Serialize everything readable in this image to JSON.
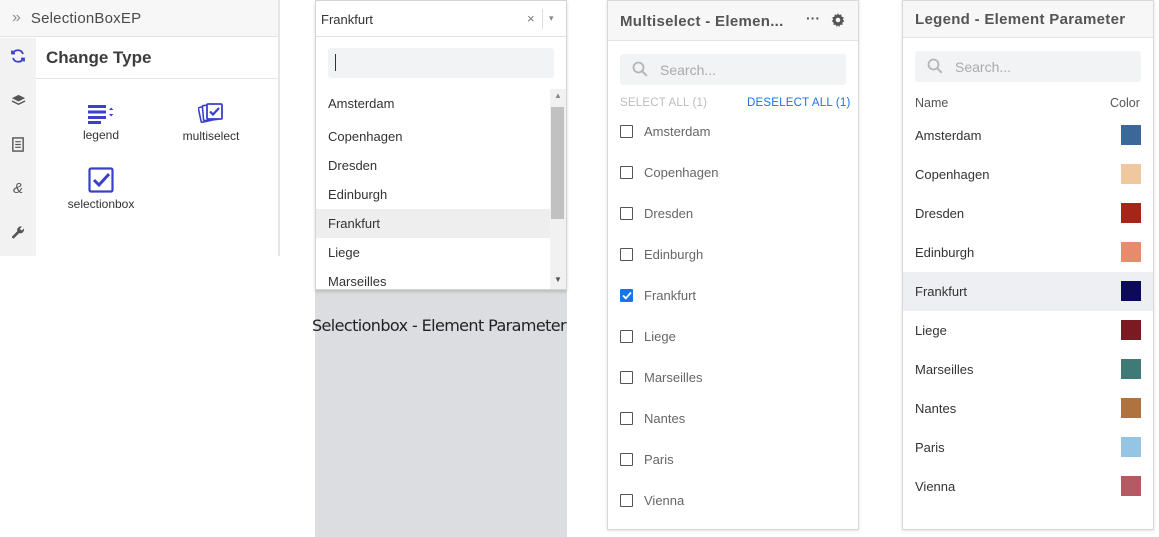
{
  "change_type": {
    "title": "SelectionBoxEP",
    "heading": "Change Type",
    "rail_icons": [
      "refresh-icon",
      "layers-icon",
      "document-icon",
      "ampersand-icon",
      "wrench-icon"
    ],
    "tiles": [
      {
        "label": "legend",
        "icon": "legend-icon"
      },
      {
        "label": "multiselect",
        "icon": "multiselect-icon"
      },
      {
        "label": "selectionbox",
        "icon": "selectionbox-icon"
      }
    ]
  },
  "selectionbox": {
    "value": "Frankfurt",
    "clear_symbol": "×",
    "arrow_symbol": "▾",
    "search_value": "",
    "items": [
      "Amsterdam",
      "Copenhagen",
      "Dresden",
      "Edinburgh",
      "Frankfurt",
      "Liege",
      "Marseilles"
    ],
    "selected": "Frankfurt",
    "caption": "Selectionbox - Element Parameter"
  },
  "multiselect": {
    "title": "Multiselect - Elemen...",
    "menu_symbol": "···",
    "search_placeholder": "Search...",
    "select_all": "SELECT ALL (1)",
    "deselect_all": "DESELECT ALL (1)",
    "items": [
      {
        "label": "Amsterdam",
        "checked": false
      },
      {
        "label": "Copenhagen",
        "checked": false
      },
      {
        "label": "Dresden",
        "checked": false
      },
      {
        "label": "Edinburgh",
        "checked": false
      },
      {
        "label": "Frankfurt",
        "checked": true
      },
      {
        "label": "Liege",
        "checked": false
      },
      {
        "label": "Marseilles",
        "checked": false
      },
      {
        "label": "Nantes",
        "checked": false
      },
      {
        "label": "Paris",
        "checked": false
      },
      {
        "label": "Vienna",
        "checked": false
      }
    ]
  },
  "legend": {
    "title": "Legend - Element Parameter",
    "search_placeholder": "Search...",
    "col_name": "Name",
    "col_color": "Color",
    "selected": "Frankfurt",
    "items": [
      {
        "name": "Amsterdam",
        "color": "#3c6799"
      },
      {
        "name": "Copenhagen",
        "color": "#f0c8a0"
      },
      {
        "name": "Dresden",
        "color": "#a52519"
      },
      {
        "name": "Edinburgh",
        "color": "#e68c6c"
      },
      {
        "name": "Frankfurt",
        "color": "#0d0a59"
      },
      {
        "name": "Liege",
        "color": "#7a1a22"
      },
      {
        "name": "Marseilles",
        "color": "#407a76"
      },
      {
        "name": "Nantes",
        "color": "#b07340"
      },
      {
        "name": "Paris",
        "color": "#96c4e4"
      },
      {
        "name": "Vienna",
        "color": "#b45a62"
      }
    ]
  },
  "colors": {
    "accent": "#1a73e8",
    "icon_indigo": "#3b40c8"
  }
}
